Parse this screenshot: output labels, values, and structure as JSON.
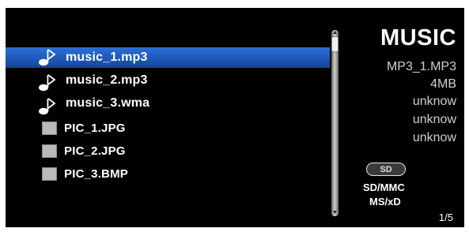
{
  "files": [
    {
      "label": "music_1.mp3",
      "icon": "music-note-icon",
      "selected": true
    },
    {
      "label": "music_2.mp3",
      "icon": "music-note-icon",
      "selected": false
    },
    {
      "label": "music_3.wma",
      "icon": "music-note-icon",
      "selected": false
    },
    {
      "label": "PIC_1.JPG",
      "icon": "picture-icon",
      "selected": false
    },
    {
      "label": "PIC_2.JPG",
      "icon": "picture-icon",
      "selected": false
    },
    {
      "label": "PIC_3.BMP",
      "icon": "picture-icon",
      "selected": false
    }
  ],
  "info": {
    "title": "MUSIC",
    "filename": "MP3_1.MP3",
    "size": "4MB",
    "detail1": "unknow",
    "detail2": "unknow",
    "detail3": "unknow"
  },
  "media": {
    "badge": "SD",
    "card_line1": "SD/MMC",
    "card_line2": "MS/xD"
  },
  "page": "1/5",
  "colors": {
    "background": "#000000",
    "selection": "#1e58b8",
    "text": "#ffffff",
    "secondary_text": "#cfcfcf"
  }
}
